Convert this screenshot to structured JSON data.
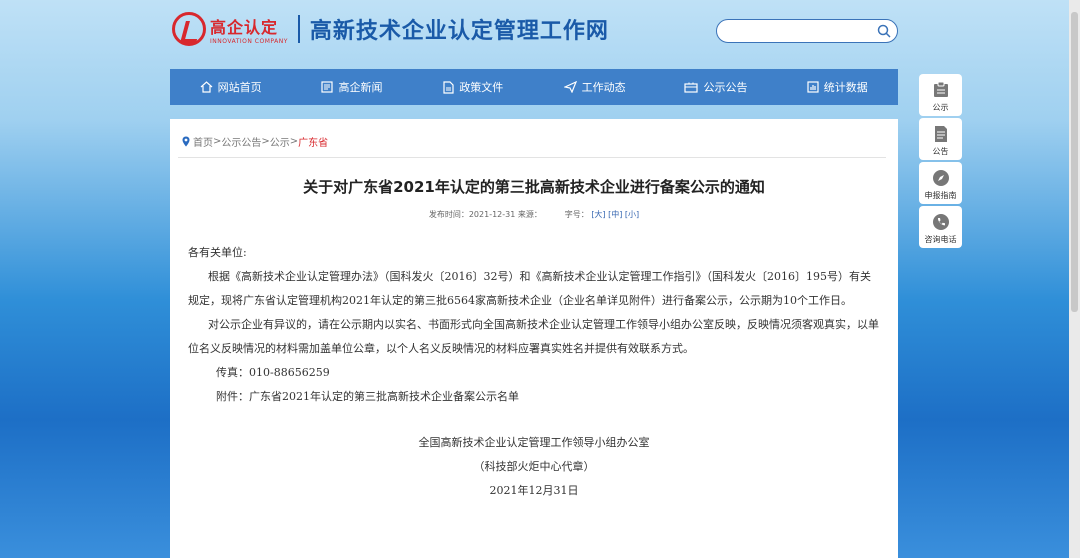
{
  "header": {
    "logo_cn": "高企认定",
    "logo_en": "INNOVATION COMPANY",
    "site_title": "高新技术企业认定管理工作网"
  },
  "search": {
    "value": "",
    "placeholder": ""
  },
  "nav": {
    "items": [
      {
        "label": "网站首页",
        "icon": "home-icon"
      },
      {
        "label": "高企新闻",
        "icon": "news-icon"
      },
      {
        "label": "政策文件",
        "icon": "document-icon"
      },
      {
        "label": "工作动态",
        "icon": "send-icon"
      },
      {
        "label": "公示公告",
        "icon": "notice-icon"
      },
      {
        "label": "统计数据",
        "icon": "chart-icon"
      }
    ]
  },
  "breadcrumb": {
    "items": [
      "首页",
      "公示公告",
      "公示"
    ],
    "separator": " > ",
    "current": "广东省"
  },
  "article": {
    "title": "关于对广东省2021年认定的第三批高新技术企业进行备案公示的通知",
    "meta": {
      "publish_label": "发布时间：",
      "publish_time": "2021-12-31",
      "source_label": "来源：",
      "font_label": "字号：",
      "size_large": "[大]",
      "size_medium": "[中]",
      "size_small": "[小]"
    },
    "salutation": "各有关单位:",
    "para1": "根据《高新技术企业认定管理办法》（国科发火〔2016〕32号）和《高新技术企业认定管理工作指引》（国科发火〔2016〕195号）有关规定，现将广东省认定管理机构2021年认定的第三批6564家高新技术企业（企业名单详见附件）进行备案公示，公示期为10个工作日。",
    "para2": "对公示企业有异议的，请在公示期内以实名、书面形式向全国高新技术企业认定管理工作领导小组办公室反映，反映情况须客观真实，以单位名义反映情况的材料需加盖单位公章，以个人名义反映情况的材料应署真实姓名并提供有效联系方式。",
    "fax": "传真：010-88656259",
    "attachment": "附件：广东省2021年认定的第三批高新技术企业备案公示名单",
    "signature_org": "全国高新技术企业认定管理工作领导小组办公室",
    "signature_sub": "（科技部火炬中心代章）",
    "signature_date": "2021年12月31日"
  },
  "side_buttons": [
    {
      "label": "公示",
      "icon": "clipboard-icon"
    },
    {
      "label": "公告",
      "icon": "notice-board-icon"
    },
    {
      "label": "申报指南",
      "icon": "compass-icon"
    },
    {
      "label": "咨询电话",
      "icon": "phone-icon"
    }
  ],
  "colors": {
    "brand_red": "#d8282d",
    "brand_blue": "#1a5aa8",
    "nav_blue": "#3f80c9"
  }
}
